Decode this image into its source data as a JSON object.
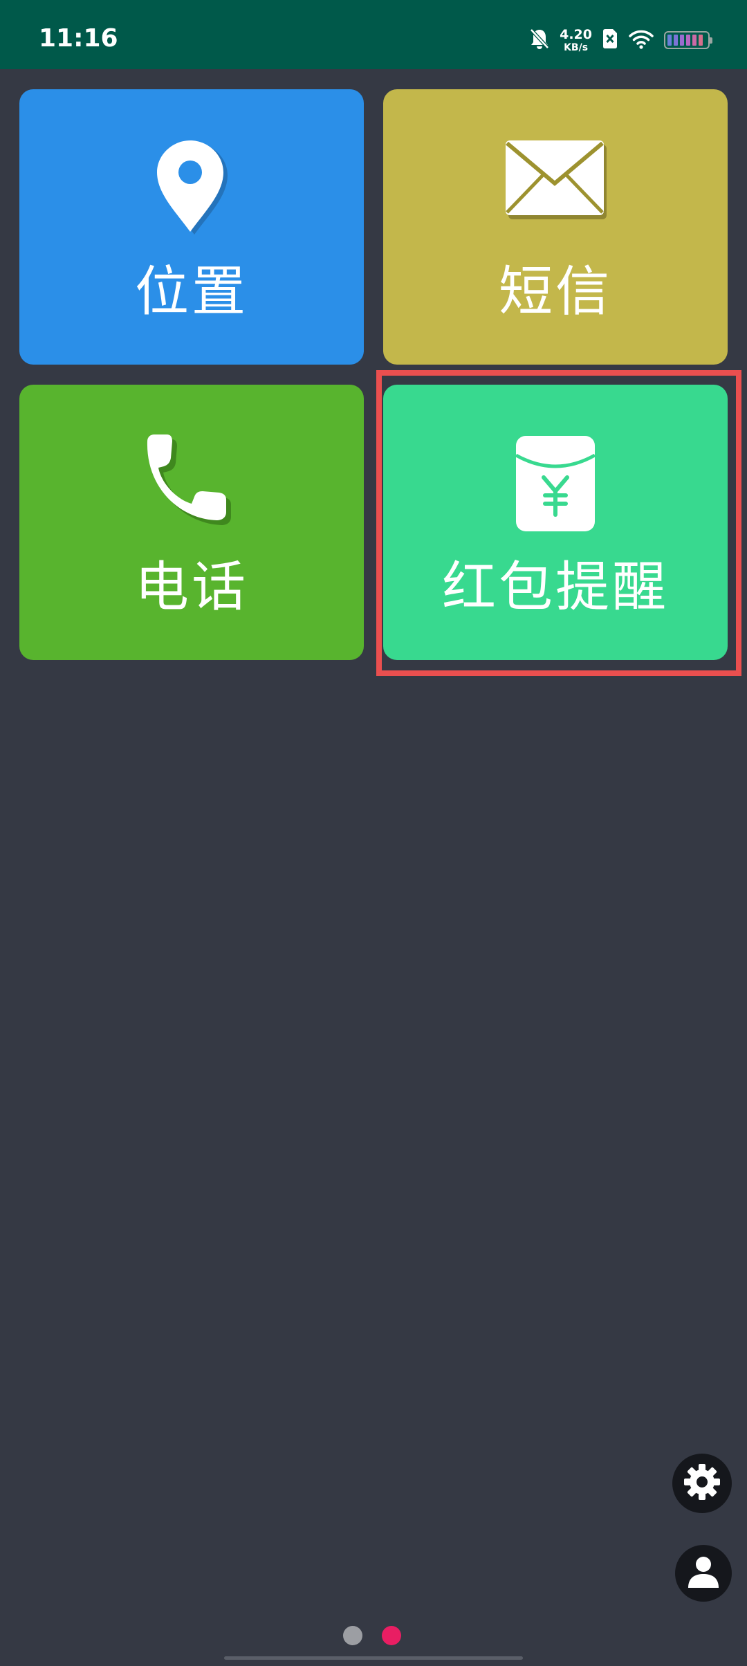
{
  "status_bar": {
    "time": "11:16",
    "net_speed_value": "4.20",
    "net_speed_unit": "KB/s",
    "icons": [
      "bell-muted-icon",
      "sim-disabled-icon",
      "wifi-icon",
      "battery-icon"
    ]
  },
  "tiles": [
    {
      "label": "位置",
      "icon": "location-pin-icon",
      "color": "#2b8fe8"
    },
    {
      "label": "短信",
      "icon": "envelope-icon",
      "color": "#c3b74b"
    },
    {
      "label": "电话",
      "icon": "phone-handset-icon",
      "color": "#58b42e"
    },
    {
      "label": "红包提醒",
      "icon": "red-envelope-yuan-icon",
      "color": "#38d98f"
    }
  ],
  "highlight_color": "#ea4f4f",
  "floating_buttons": [
    "gear-icon",
    "user-icon"
  ],
  "page_indicator": {
    "count": 2,
    "active_index": 1,
    "active_color": "#e91e63",
    "inactive_color": "#9c9ea3"
  },
  "colors": {
    "status_bar_bg": "#00594a",
    "page_bg": "#353944"
  }
}
